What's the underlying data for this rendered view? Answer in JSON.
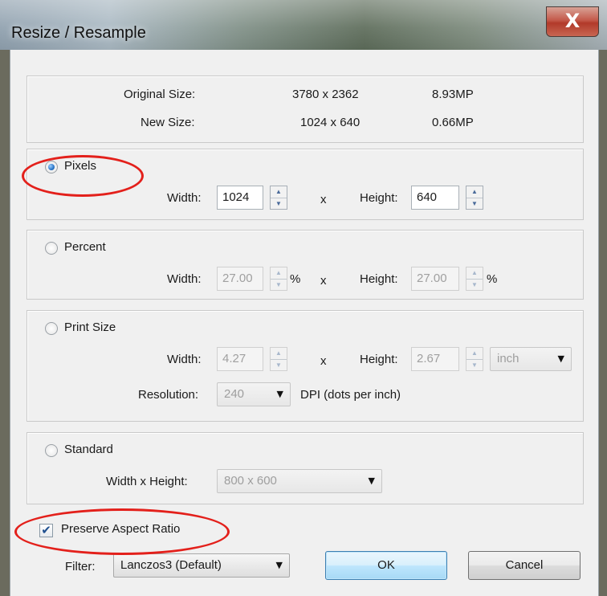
{
  "window": {
    "title": "Resize / Resample",
    "close_glyph": "X"
  },
  "summary": {
    "original_label": "Original Size:",
    "original_dims": "3780 x 2362",
    "original_mp": "8.93MP",
    "new_label": "New Size:",
    "new_dims": "1024 x 640",
    "new_mp": "0.66MP"
  },
  "pixels": {
    "label": "Pixels",
    "selected": true,
    "width_label": "Width:",
    "width_value": "1024",
    "x": "x",
    "height_label": "Height:",
    "height_value": "640"
  },
  "percent": {
    "label": "Percent",
    "width_label": "Width:",
    "width_value": "27.00",
    "width_unit": "%",
    "x": "x",
    "height_label": "Height:",
    "height_value": "27.00",
    "height_unit": "%"
  },
  "print_size": {
    "label": "Print Size",
    "width_label": "Width:",
    "width_value": "4.27",
    "x": "x",
    "height_label": "Height:",
    "height_value": "2.67",
    "unit_selected": "inch",
    "resolution_label": "Resolution:",
    "resolution_value": "240",
    "resolution_unit": "DPI (dots per inch)"
  },
  "standard": {
    "label": "Standard",
    "size_label": "Width x Height:",
    "size_value": "800 x 600"
  },
  "preserve_aspect": {
    "label": "Preserve Aspect Ratio",
    "checked": true,
    "check_glyph": "✔"
  },
  "filter": {
    "label": "Filter:",
    "value": "Lanczos3 (Default)"
  },
  "buttons": {
    "ok": "OK",
    "cancel": "Cancel"
  },
  "icons": {
    "spin_up": "▲",
    "spin_down": "▼",
    "dropdown": "▼"
  },
  "colors": {
    "annotation": "#e3201b",
    "accent": "#2a76c8"
  }
}
